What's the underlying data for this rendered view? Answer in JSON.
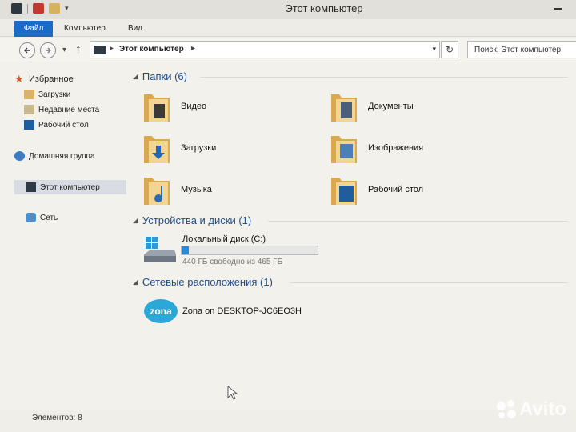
{
  "window": {
    "title": "Этот компьютер"
  },
  "ribbon": {
    "tabs": [
      {
        "label": "Файл"
      },
      {
        "label": "Компьютер"
      },
      {
        "label": "Вид"
      }
    ]
  },
  "address_bar": {
    "path": "Этот компьютер",
    "search_placeholder": "Поиск: Этот компьютер"
  },
  "sidebar": {
    "items": [
      {
        "label": "Избранное",
        "icon": "star-icon"
      },
      {
        "label": "Загрузки",
        "icon": "downloads-folder-icon"
      },
      {
        "label": "Недавние места",
        "icon": "recent-places-icon"
      },
      {
        "label": "Рабочий стол",
        "icon": "desktop-icon"
      },
      {
        "label": "Домашняя группа",
        "icon": "homegroup-icon"
      },
      {
        "label": "Этот компьютер",
        "icon": "computer-icon"
      },
      {
        "label": "Сеть",
        "icon": "network-icon"
      }
    ]
  },
  "groups": {
    "folders": {
      "header": "Папки (6)",
      "items": [
        {
          "label": "Видео",
          "icon": "videos-folder-icon"
        },
        {
          "label": "Документы",
          "icon": "documents-folder-icon"
        },
        {
          "label": "Загрузки",
          "icon": "downloads-folder-icon"
        },
        {
          "label": "Изображения",
          "icon": "pictures-folder-icon"
        },
        {
          "label": "Музыка",
          "icon": "music-folder-icon"
        },
        {
          "label": "Рабочий стол",
          "icon": "desktop-folder-icon"
        }
      ]
    },
    "devices": {
      "header": "Устройства и диски (1)",
      "drive": {
        "name": "Локальный диск (C:)",
        "free_text": "440 ГБ свободно из 465 ГБ",
        "used_fraction": 0.054,
        "icon": "hard-drive-icon"
      }
    },
    "network": {
      "header": "Сетевые расположения (1)",
      "item": {
        "label": "Zona on DESKTOP-JC6EO3H",
        "icon_text": "zona",
        "icon": "zona-icon"
      }
    }
  },
  "status": {
    "text": "Элементов: 8"
  },
  "watermark": {
    "text": "Avito"
  },
  "colors": {
    "accent": "#1c6ac8",
    "group_header": "#1f4e8c",
    "drive_fill": "#2a8ad6",
    "folder": "#e9c27a"
  }
}
